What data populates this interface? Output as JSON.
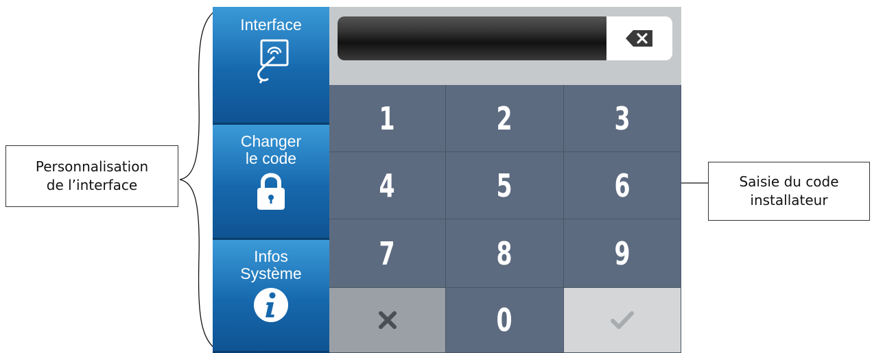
{
  "annotations": {
    "left": "Personnalisation\nde l’interface",
    "right": "Saisie du code\ninstallateur"
  },
  "sidebar": {
    "interface_label": "Interface",
    "change_code_label": "Changer\nle code",
    "system_info_label": "Infos\nSystème"
  },
  "keypad": {
    "keys": [
      "1",
      "2",
      "3",
      "4",
      "5",
      "6",
      "7",
      "8",
      "9",
      "0"
    ]
  },
  "colors": {
    "sidebar_blue": "#1668ad",
    "keypad_gray": "#5d6b80",
    "cancel_gray": "#9aa0a6",
    "ok_gray": "#d4d6d8"
  }
}
